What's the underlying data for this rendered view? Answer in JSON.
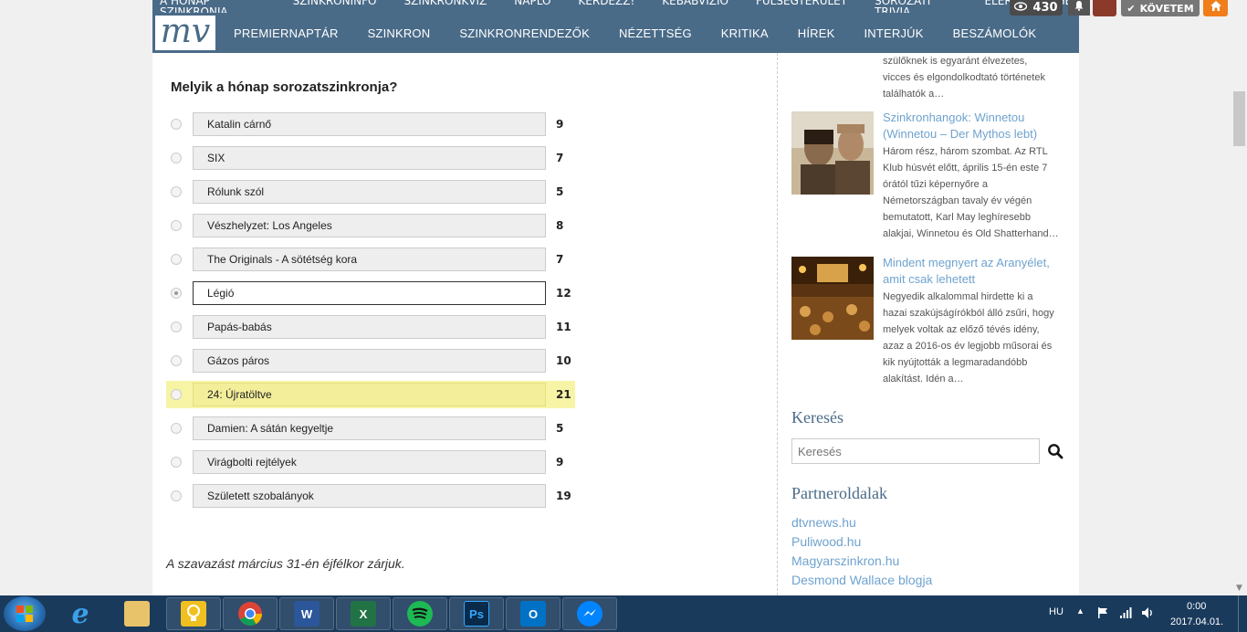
{
  "topbar": {
    "items": [
      "A HÓNAP SZINKRONJA",
      "SZINKRONINFÓ",
      "SZINKRONKVÍZ",
      "NAPLÓ",
      "KÉRDEZZ!",
      "KEBABVÍZIÓ",
      "FÜLSÉGTERÜLET",
      "SOROZATI TRIVIA",
      "ELÉRHETŐSÉGEK"
    ]
  },
  "logo": {
    "text": "mv"
  },
  "nav": {
    "items": [
      "PREMIERNAPTÁR",
      "SZINKRON",
      "SZINKRONRENDEZŐK",
      "NÉZETTSÉG",
      "KRITIKA",
      "HÍREK",
      "INTERJÚK",
      "BESZÁMOLÓK"
    ]
  },
  "header_widgets": {
    "views": "430",
    "follow_label": "KÖVETEM"
  },
  "poll": {
    "title": "Melyik a hónap sorozatszinkronja?",
    "options": [
      {
        "label": "Katalin cárnő",
        "count": "9"
      },
      {
        "label": "SIX",
        "count": "7"
      },
      {
        "label": "Rólunk szól",
        "count": "5"
      },
      {
        "label": "Vészhelyzet: Los Angeles",
        "count": "8"
      },
      {
        "label": "The Originals - A sötétség kora",
        "count": "7"
      },
      {
        "label": "Légió",
        "count": "12"
      },
      {
        "label": "Papás-babás",
        "count": "11"
      },
      {
        "label": "Gázos páros",
        "count": "10"
      },
      {
        "label": "24: Újratöltve",
        "count": "21"
      },
      {
        "label": "Damien: A sátán kegyeltje",
        "count": "5"
      },
      {
        "label": "Virágbolti rejtélyek",
        "count": "9"
      },
      {
        "label": "Született szobalányok",
        "count": "19"
      }
    ],
    "selected_index": 5,
    "highlighted_index": 8,
    "closing": "A szavazást március 31-én éjfélkor zárjuk."
  },
  "sidebar": {
    "snippet_lines": [
      "szülőknek is egyaránt élvezetes,",
      "vicces és elgondolkodtató történetek",
      "találhatók a…"
    ],
    "articles": [
      {
        "title_lines": [
          "Szinkronhangok: Winnetou",
          "(Winnetou – Der Mythos lebt)"
        ],
        "text_lines": [
          "Három rész, három szombat. Az RTL",
          "Klub húsvét előtt, április 15-én este 7",
          "órától tűzi képernyőre a",
          "Németországban tavaly év végén",
          "bemutatott, Karl May leghíresebb",
          "alakjai, Winnetou és Old Shatterhand…"
        ]
      },
      {
        "title_lines": [
          "Mindent megnyert az Aranyélet,",
          "amit csak lehetett"
        ],
        "text_lines": [
          "Negyedik alkalommal hirdette ki a",
          "hazai szakújságírókból álló zsűri, hogy",
          "melyek voltak az előző tévés idény,",
          "azaz a 2016-os év legjobb műsorai és",
          "kik nyújtották a legmaradandóbb",
          "alakítást. Idén a…"
        ]
      }
    ],
    "search": {
      "heading": "Keresés",
      "placeholder": "Keresés"
    },
    "partners": {
      "heading": "Partneroldalak",
      "links": [
        "dtvnews.hu",
        "Puliwood.hu",
        "Magyarszinkron.hu",
        "Desmond Wallace blogja"
      ]
    }
  },
  "taskbar": {
    "apps": [
      "internet-explorer",
      "file-explorer",
      "bulb-app",
      "chrome",
      "word",
      "excel",
      "spotify",
      "photoshop",
      "outlook",
      "messenger"
    ],
    "tray": {
      "lang": "HU",
      "time": "0:00",
      "date": "2017.04.01."
    }
  }
}
